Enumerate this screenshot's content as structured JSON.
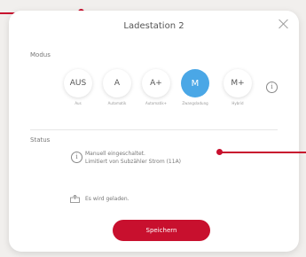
{
  "dialog": {
    "title": "Ladestation 2",
    "modus_label": "Modus",
    "status_label": "Status",
    "save_label": "Speichern"
  },
  "modes": [
    {
      "label": "AUS",
      "caption": "Aus",
      "active": false
    },
    {
      "label": "A",
      "caption": "Automatik",
      "active": false
    },
    {
      "label": "A+",
      "caption": "Automatik+",
      "active": false
    },
    {
      "label": "M",
      "caption": "Zwangsladung",
      "active": true
    },
    {
      "label": "M+",
      "caption": "Hybrid",
      "active": false
    }
  ],
  "status": {
    "line1": "Manuell eingeschaltet.",
    "line2": "Limitiert von Subzähler Strom (11A)",
    "charging": "Es wird geladen."
  },
  "colors": {
    "accent": "#c8102e",
    "active_mode": "#4aa7e6"
  },
  "icons": [
    "close-icon",
    "info-icon",
    "charging-icon"
  ]
}
